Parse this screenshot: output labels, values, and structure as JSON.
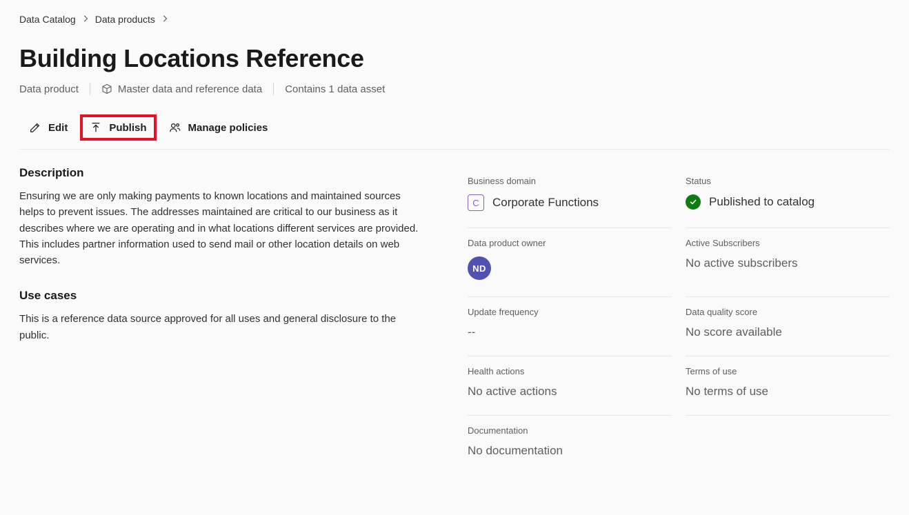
{
  "breadcrumb": {
    "root": "Data Catalog",
    "section": "Data products"
  },
  "header": {
    "title": "Building Locations Reference",
    "type_label": "Data product",
    "category_label": "Master data and reference data",
    "asset_count_label": "Contains 1 data asset"
  },
  "toolbar": {
    "edit_label": "Edit",
    "publish_label": "Publish",
    "manage_policies_label": "Manage policies"
  },
  "main": {
    "description_heading": "Description",
    "description_body": "Ensuring we are only making payments to known locations and maintained sources helps to prevent issues.  The addresses maintained are critical to our business as it describes where we are operating and in what locations different services are provided.  This includes partner information used to send mail or other location details on web services.",
    "use_cases_heading": "Use cases",
    "use_cases_body": "This is a reference data source approved for all uses and general disclosure to the public."
  },
  "info": {
    "business_domain": {
      "label": "Business domain",
      "badge_letter": "C",
      "value": "Corporate Functions"
    },
    "status": {
      "label": "Status",
      "value": "Published to catalog"
    },
    "owner": {
      "label": "Data product owner",
      "initials": "ND"
    },
    "subscribers": {
      "label": "Active Subscribers",
      "value": "No active subscribers"
    },
    "update_freq": {
      "label": "Update frequency",
      "value": "--"
    },
    "dq_score": {
      "label": "Data quality score",
      "value": "No score available"
    },
    "health": {
      "label": "Health actions",
      "value": "No active actions"
    },
    "terms": {
      "label": "Terms of use",
      "value": "No terms of use"
    },
    "docs": {
      "label": "Documentation",
      "value": "No documentation"
    }
  }
}
